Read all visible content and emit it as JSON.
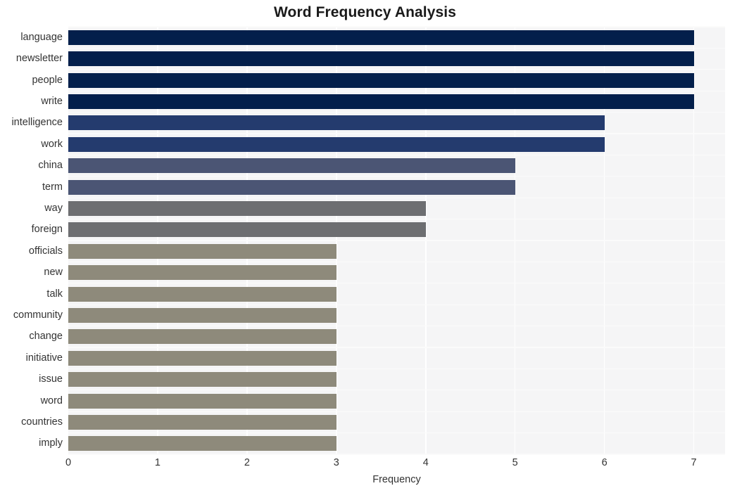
{
  "chart_data": {
    "type": "bar",
    "orientation": "horizontal",
    "title": "Word Frequency Analysis",
    "xlabel": "Frequency",
    "ylabel": "",
    "xlim": [
      0,
      7.35
    ],
    "ylim": [
      0,
      20
    ],
    "grid": true,
    "legend": null,
    "xticks": [
      "0",
      "1",
      "2",
      "3",
      "4",
      "5",
      "6",
      "7"
    ],
    "xtick_values": [
      0,
      1,
      2,
      3,
      4,
      5,
      6,
      7
    ],
    "categories": [
      "language",
      "newsletter",
      "people",
      "write",
      "intelligence",
      "work",
      "china",
      "term",
      "way",
      "foreign",
      "officials",
      "new",
      "talk",
      "community",
      "change",
      "initiative",
      "issue",
      "word",
      "countries",
      "imply"
    ],
    "values": [
      7,
      7,
      7,
      7,
      6,
      6,
      5,
      5,
      4,
      4,
      3,
      3,
      3,
      3,
      3,
      3,
      3,
      3,
      3,
      3
    ],
    "bar_colors": [
      "#031f4b",
      "#031f4b",
      "#031f4b",
      "#031f4b",
      "#243b6e",
      "#243b6e",
      "#4b5574",
      "#4b5574",
      "#6d6e71",
      "#6d6e71",
      "#8e8a7b",
      "#8e8a7b",
      "#8e8a7b",
      "#8e8a7b",
      "#8e8a7b",
      "#8e8a7b",
      "#8e8a7b",
      "#8e8a7b",
      "#8e8a7b",
      "#8e8a7b"
    ],
    "plot_background": "#f5f5f6",
    "gridline_color": "#ffffff",
    "figure_background": "#ffffff",
    "title_color": "#1a1a1a",
    "tick_label_color": "#333333"
  }
}
